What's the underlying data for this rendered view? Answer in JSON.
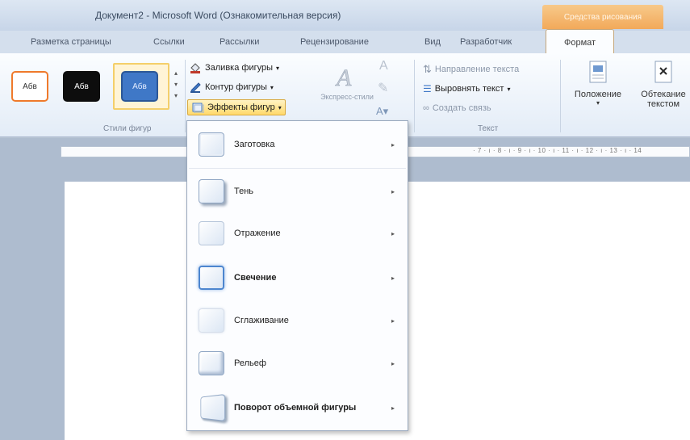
{
  "window": {
    "title": "Документ2 - Microsoft Word (Ознакомительная версия)"
  },
  "contextual_tab_group": {
    "label": "Средства рисования"
  },
  "tabs": [
    {
      "label": "Разметка страницы"
    },
    {
      "label": "Ссылки"
    },
    {
      "label": "Рассылки"
    },
    {
      "label": "Рецензирование"
    },
    {
      "label": "Вид"
    },
    {
      "label": "Разработчик"
    },
    {
      "label": "Формат"
    }
  ],
  "ribbon": {
    "shape_styles": {
      "group_label": "Стили фигур",
      "swatches": [
        "Абв",
        "Абв",
        "Абв"
      ]
    },
    "commands": {
      "fill": "Заливка фигуры",
      "outline": "Контур фигуры",
      "effects": "Эффекты фигур"
    },
    "wordart": {
      "label": "Экспресс-стили"
    },
    "text_group": {
      "direction": "Направление текста",
      "align": "Выровнять текст",
      "link": "Создать связь",
      "group_label": "Текст"
    },
    "arrange": {
      "position": "Положение",
      "wrap_line1": "Обтекание",
      "wrap_line2": "текстом"
    }
  },
  "ruler": {
    "marks": "· 7 · ı · 8 · ı · 9 · ı · 10 · ı · 11 · ı · 12 · ı · 13 · ı · 14"
  },
  "effects_menu": {
    "items": [
      {
        "label": "Заготовка",
        "bold": false
      },
      {
        "label": "Тень",
        "bold": false
      },
      {
        "label": "Отражение",
        "bold": false
      },
      {
        "label": "Свечение",
        "bold": true
      },
      {
        "label": "Сглаживание",
        "bold": false
      },
      {
        "label": "Рельеф",
        "bold": false
      },
      {
        "label": "Поворот объемной фигуры",
        "bold": false
      }
    ]
  },
  "colors": {
    "accent": "#f2a95a",
    "highlight": "#ffd96b",
    "style_blue": "#3f78c7"
  }
}
